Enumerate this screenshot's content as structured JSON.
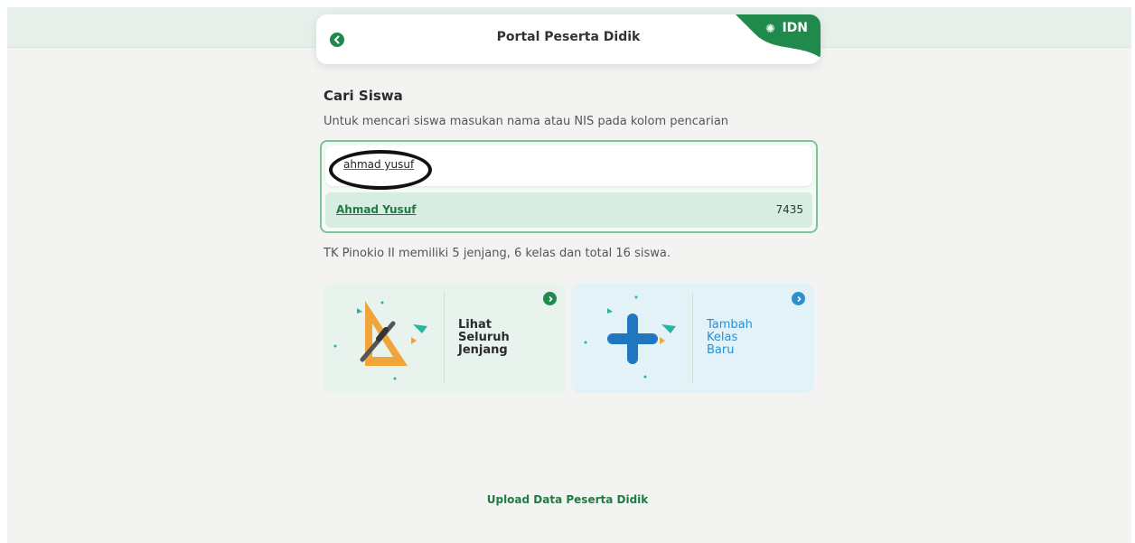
{
  "header": {
    "title": "Portal Peserta Didik",
    "brand": "IDN"
  },
  "search_section": {
    "title": "Cari Siswa",
    "description": "Untuk mencari siswa masukan nama atau NIS pada kolom pencarian",
    "input_value": "ahmad yusuf",
    "results": [
      {
        "name": "Ahmad Yusuf",
        "nis": "7435"
      }
    ]
  },
  "school_section": {
    "description": "TK Pinokio II memiliki 5 jenjang, 6 kelas dan total 16 siswa."
  },
  "cards": [
    {
      "label": "Lihat Seluruh Jenjang",
      "accent": "#1f8a4c"
    },
    {
      "label": "Tambah Kelas Baru",
      "accent": "#2b8fd0"
    }
  ],
  "footer": {
    "upload_link": "Upload Data Peserta Didik"
  },
  "colors": {
    "brand_green": "#1f8a4c",
    "accent_blue": "#2b8fd0"
  }
}
